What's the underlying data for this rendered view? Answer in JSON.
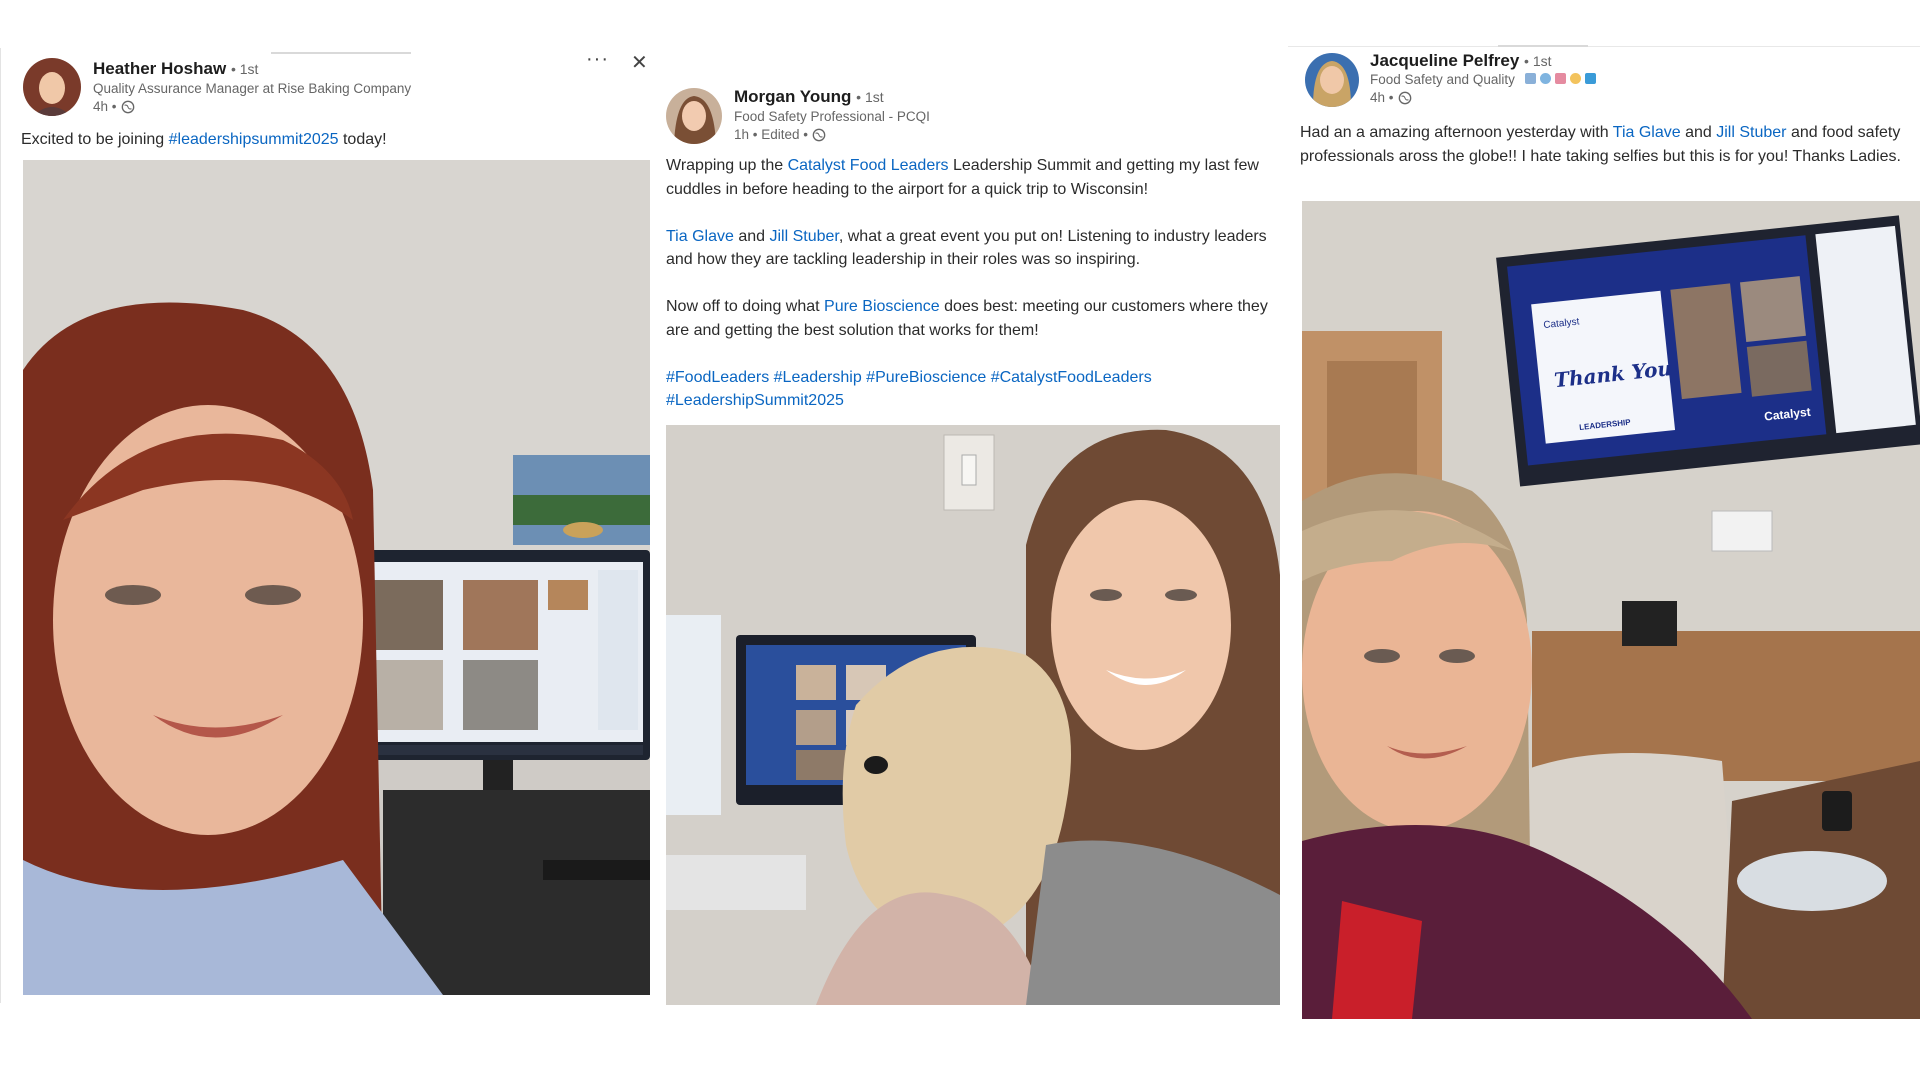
{
  "posts": [
    {
      "author": "Heather Hoshaw",
      "degree": "• 1st",
      "headline": "Quality Assurance Manager at Rise Baking Company",
      "time": "4h •",
      "text": {
        "pre": "Excited to be joining ",
        "hashtag": "#leadershipsummit2025",
        "post": " today!"
      },
      "controls": {
        "more_label": "···",
        "close_label": "✕"
      },
      "icons": [
        "globe-icon",
        "more-icon",
        "close-icon"
      ]
    },
    {
      "author": "Morgan Young",
      "degree": "• 1st",
      "headline": "Food Safety Professional - PCQI",
      "time": "1h • Edited •",
      "p1": {
        "a": "Wrapping up the ",
        "link": "Catalyst Food Leaders",
        "b": " Leadership Summit and getting my last few cuddles in before heading to the airport for a quick trip to Wisconsin!"
      },
      "p2": {
        "link1": "Tia Glave",
        "and": " and ",
        "link2": "Jill Stuber",
        "rest": ", what a great event you put on! Listening to industry leaders and how they are tackling leadership in their roles was so inspiring."
      },
      "p3": {
        "a": "Now off to doing what ",
        "link": "Pure Bioscience",
        "b": " does best: meeting our customers where they are and getting the best solution that works for them!"
      },
      "hashtags": [
        "#FoodLeaders",
        "#Leadership",
        "#PureBioscience",
        "#CatalystFoodLeaders",
        "#LeadershipSummit2025"
      ]
    },
    {
      "author": "Jacqueline Pelfrey",
      "degree": "• 1st",
      "headline": "Food Safety and Quality",
      "time": "4h •",
      "text": {
        "a": "Had an a amazing afternoon yesterday with ",
        "link1": "Tia Glave",
        "and": " and ",
        "link2": "Jill Stuber",
        "b": " and food safety professionals aross the globe!! I hate taking selfies but this is for you! Thanks Ladies."
      },
      "tv": {
        "title": "Catalyst",
        "thank": "Thank You!",
        "footer": "LEADERSHIP",
        "brand": "Catalyst"
      }
    }
  ],
  "colors": {
    "link": "#0a66c2",
    "meta": "#666666",
    "name": "#1d1d1d"
  }
}
